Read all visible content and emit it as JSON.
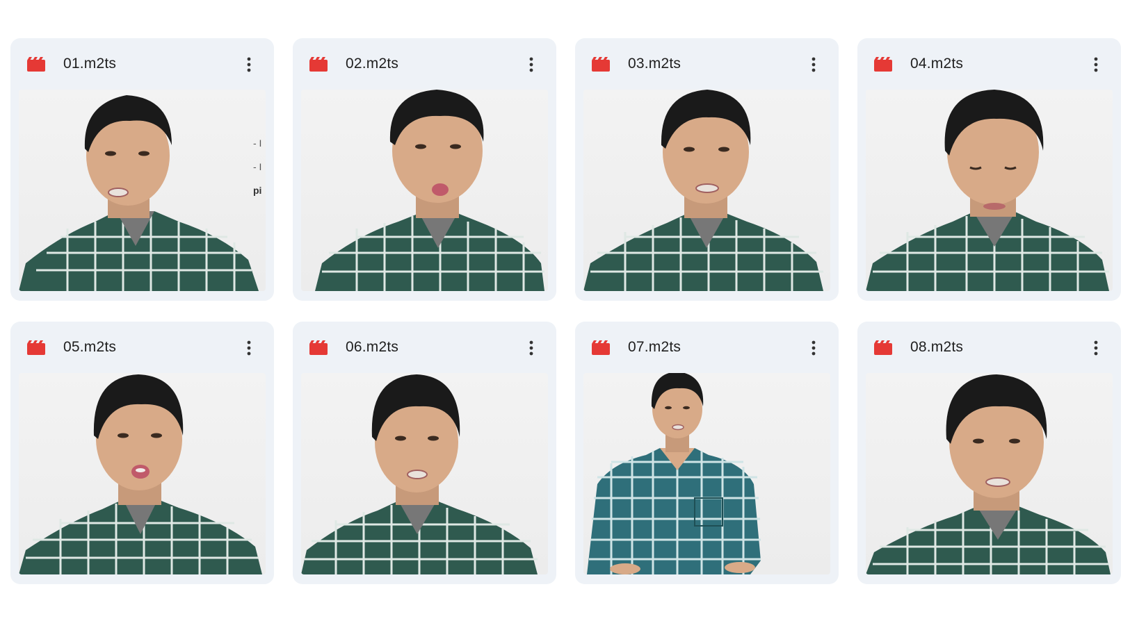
{
  "files": [
    {
      "name": "01.m2ts",
      "icon": "video-clapper-icon",
      "menu_icon": "more-vert-icon"
    },
    {
      "name": "02.m2ts",
      "icon": "video-clapper-icon",
      "menu_icon": "more-vert-icon"
    },
    {
      "name": "03.m2ts",
      "icon": "video-clapper-icon",
      "menu_icon": "more-vert-icon"
    },
    {
      "name": "04.m2ts",
      "icon": "video-clapper-icon",
      "menu_icon": "more-vert-icon"
    },
    {
      "name": "05.m2ts",
      "icon": "video-clapper-icon",
      "menu_icon": "more-vert-icon"
    },
    {
      "name": "06.m2ts",
      "icon": "video-clapper-icon",
      "menu_icon": "more-vert-icon"
    },
    {
      "name": "07.m2ts",
      "icon": "video-clapper-icon",
      "menu_icon": "more-vert-icon"
    },
    {
      "name": "08.m2ts",
      "icon": "video-clapper-icon",
      "menu_icon": "more-vert-icon"
    }
  ],
  "thumb_overlay_text": [
    "- I",
    "- I",
    "pi"
  ],
  "colors": {
    "card_background": "#eef2f7",
    "file_icon_red": "#e53935",
    "shirt_green": "#2f5a4f",
    "shirt_teal": "#2f6f7a"
  }
}
